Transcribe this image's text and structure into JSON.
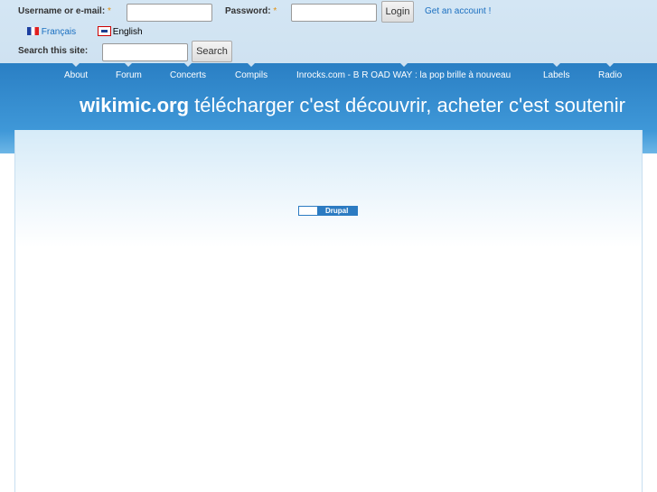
{
  "login": {
    "username_label": "Username or e-mail:",
    "password_label": "Password:",
    "required_mark": "*",
    "login_button": "Login",
    "register_link": "Get an account !"
  },
  "languages": [
    {
      "label": "Français"
    },
    {
      "label": "English"
    }
  ],
  "search": {
    "label": "Search this site:",
    "button": "Search",
    "value": ""
  },
  "nav": [
    "About",
    "Forum",
    "Concerts",
    "Compils",
    "Inrocks.com - B R OAD WAY : la pop brille à nouveau",
    "Labels",
    "Radio"
  ],
  "site": {
    "name": "wikimic.org",
    "slogan": "télécharger c'est découvrir, acheter c'est soutenir"
  },
  "footer_badge": "Drupal"
}
